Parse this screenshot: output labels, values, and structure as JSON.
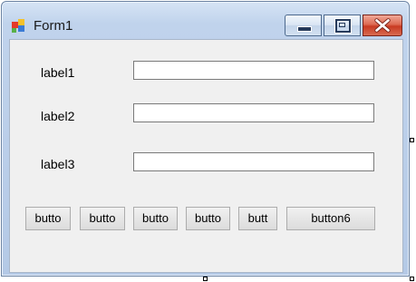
{
  "window": {
    "title": "Form1"
  },
  "labels": [
    "label1",
    "label2",
    "label3"
  ],
  "textboxes": [
    "",
    "",
    ""
  ],
  "buttons": [
    "butto",
    "butto",
    "butto",
    "butto",
    "butt",
    "button6"
  ]
}
